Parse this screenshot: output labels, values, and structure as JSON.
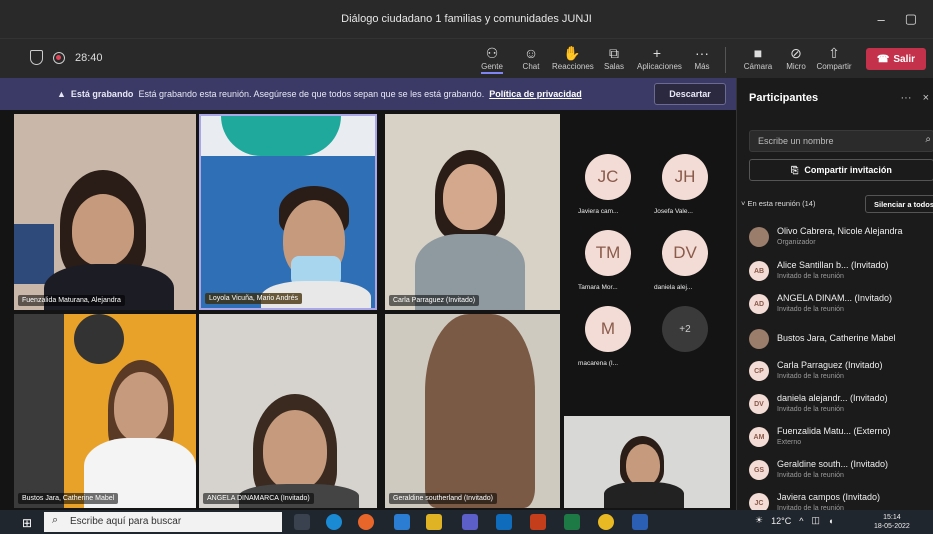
{
  "window": {
    "title": "Diálogo ciudadano 1 familias y comunidades JUNJI",
    "minimize": "–",
    "maximize": "▢"
  },
  "toolbar": {
    "timer": "28:40",
    "buttons": [
      {
        "label": "Gente",
        "icon": "people-icon"
      },
      {
        "label": "Chat",
        "icon": "chat-icon"
      },
      {
        "label": "Reacciones",
        "icon": "reactions-icon"
      },
      {
        "label": "Salas",
        "icon": "rooms-icon"
      },
      {
        "label": "Aplicaciones",
        "icon": "apps-icon"
      },
      {
        "label": "Más",
        "icon": "more-icon"
      },
      {
        "label": "Cámara",
        "icon": "camera-icon"
      },
      {
        "label": "Micro",
        "icon": "mic-off-icon"
      },
      {
        "label": "Compartir",
        "icon": "share-icon"
      }
    ],
    "leave_label": "Salir"
  },
  "banner": {
    "strong": "Está grabando",
    "text": "Está grabando esta reunión. Asegúrese de que todos sepan que se les está grabando.",
    "link": "Política de privacidad",
    "dismiss": "Descartar"
  },
  "videos": [
    {
      "name": "Fuenzalida Maturana, Alejandra"
    },
    {
      "name": "Loyola Vicuña, Mario Andrés"
    },
    {
      "name": "Carla Parraguez (Invitado)"
    },
    {
      "name": "Bustos Jara, Catherine Mabel"
    },
    {
      "name": "ANGELA DINAMARCA (Invitado)"
    },
    {
      "name": "Geraldine southerland (Invitado)"
    }
  ],
  "avatars": [
    {
      "initials": "JC",
      "label": "Javiera cam..."
    },
    {
      "initials": "JH",
      "label": "Josefa Vale..."
    },
    {
      "initials": "TM",
      "label": "Tamara Mor..."
    },
    {
      "initials": "DV",
      "label": "daniela alej..."
    },
    {
      "initials": "M",
      "label": "macarena (I..."
    },
    {
      "initials": "+2",
      "label": ""
    }
  ],
  "panel": {
    "title": "Participantes",
    "more": "···",
    "close": "×",
    "search_placeholder": "Escribe un nombre",
    "share_label": "Compartir invitación",
    "section": "En esta reunión (14)",
    "mute_all": "Silenciar a todos",
    "participants": [
      {
        "initials": "",
        "name": "Olivo Cabrera, Nicole Alejandra",
        "role": "Organizador",
        "photo": true
      },
      {
        "initials": "AB",
        "name": "Alice Santillan b...  (Invitado)",
        "role": "Invitado de la reunión",
        "photo": false
      },
      {
        "initials": "AD",
        "name": "ANGELA DINAM...  (Invitado)",
        "role": "Invitado de la reunión",
        "photo": false
      },
      {
        "initials": "",
        "name": "Bustos Jara, Catherine Mabel",
        "role": "",
        "photo": true
      },
      {
        "initials": "CP",
        "name": "Carla Parraguez (Invitado)",
        "role": "Invitado de la reunión",
        "photo": false
      },
      {
        "initials": "DV",
        "name": "daniela alejandr...  (Invitado)",
        "role": "Invitado de la reunión",
        "photo": false
      },
      {
        "initials": "AM",
        "name": "Fuenzalida Matu...  (Externo)",
        "role": "Externo",
        "photo": false
      },
      {
        "initials": "GS",
        "name": "Geraldine south...  (Invitado)",
        "role": "Invitado de la reunión",
        "photo": false
      },
      {
        "initials": "JC",
        "name": "Javiera campos (Invitado)",
        "role": "Invitado de la reunión",
        "photo": false
      }
    ]
  },
  "taskbar": {
    "search_placeholder": "Escribe aquí para buscar",
    "temperature": "12°C",
    "time": "15:14",
    "date": "18-05-2022"
  },
  "colors": {
    "leave": "#c4314b",
    "banner": "#3b3a66",
    "accent": "#7f85f5"
  }
}
